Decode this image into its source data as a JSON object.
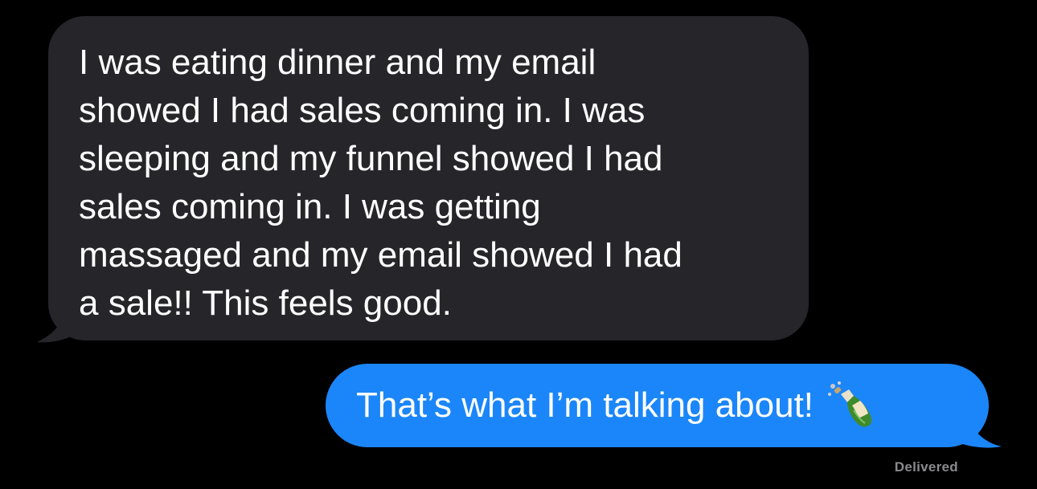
{
  "messages": {
    "received": {
      "text": "I was eating dinner and my email\nshowed I had sales coming in. I was\nsleeping and my funnel showed I had\nsales coming in. I was getting\nmassaged and my email showed I had\na sale!! This feels good."
    },
    "sent": {
      "text": "That’s what I’m talking about!",
      "emoji": "champagne-bottle-icon"
    }
  },
  "status": "Delivered",
  "colors": {
    "background": "#000000",
    "received_bubble": "#26252a",
    "sent_bubble": "#1b86f9",
    "status_text": "#8a8a8e"
  }
}
